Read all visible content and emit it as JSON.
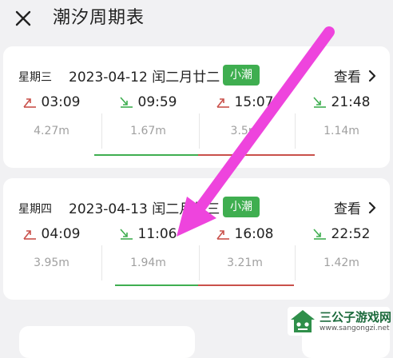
{
  "header": {
    "title": "潮汐周期表"
  },
  "cards": [
    {
      "weekday": "星期三",
      "date": "2023-04-12 闰二月廿二",
      "badge": "小潮",
      "view_label": "查看",
      "tides": [
        {
          "type": "high",
          "time": "03:09",
          "height": "4.27m"
        },
        {
          "type": "low",
          "time": "09:59",
          "height": "1.67m"
        },
        {
          "type": "high",
          "time": "15:07",
          "height": "3.5m"
        },
        {
          "type": "low",
          "time": "21:48",
          "height": "1.14m"
        }
      ]
    },
    {
      "weekday": "星期四",
      "date": "2023-04-13 闰二月廿三",
      "badge": "小潮",
      "view_label": "查看",
      "tides": [
        {
          "type": "high",
          "time": "04:09",
          "height": "3.95m"
        },
        {
          "type": "low",
          "time": "11:06",
          "height": "1.94m"
        },
        {
          "type": "high",
          "time": "16:08",
          "height": "3.21m"
        },
        {
          "type": "low",
          "time": "22:52",
          "height": "1.42m"
        }
      ]
    }
  ],
  "colors": {
    "badge": "#3fae50",
    "high_tide": "#c9504a",
    "low_tide": "#3fae50",
    "arrow": "#ee44dd"
  },
  "watermark": {
    "title": "三公子游戏网",
    "url": "www.sangongzi.net"
  }
}
